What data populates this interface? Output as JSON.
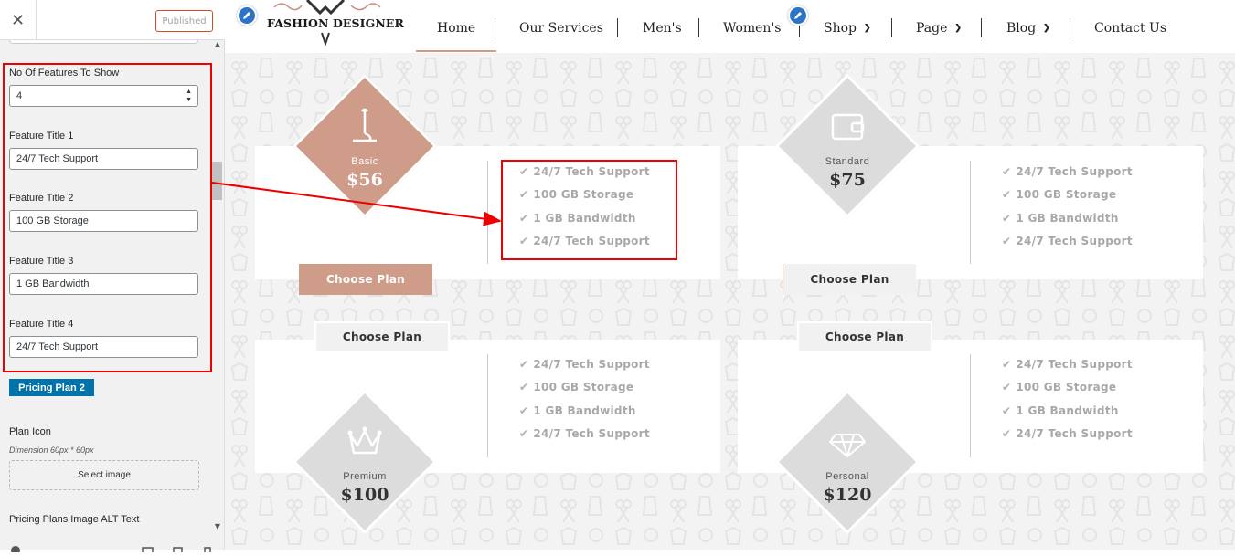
{
  "customizer": {
    "close_icon": "close-icon",
    "published_label": "Published",
    "features_count_label": "No Of Features To Show",
    "features_count_value": "4",
    "feature_fields": [
      {
        "label": "Feature Title 1",
        "value": "24/7 Tech Support"
      },
      {
        "label": "Feature Title 2",
        "value": "100 GB Storage"
      },
      {
        "label": "Feature Title 3",
        "value": "1 GB Bandwidth"
      },
      {
        "label": "Feature Title 4",
        "value": "24/7 Tech Support"
      }
    ],
    "section_button": "Pricing Plan 2",
    "plan_icon_label": "Plan Icon",
    "plan_icon_hint": "Dimension 60px * 60px",
    "select_image_label": "Select image",
    "alt_text_label": "Pricing Plans Image ALT Text"
  },
  "site": {
    "logo_text": "FASHION DESIGNER",
    "nav": [
      {
        "label": "Home"
      },
      {
        "label": "Our Services"
      },
      {
        "label": "Men's"
      },
      {
        "label": "Women's"
      },
      {
        "label": "Shop"
      },
      {
        "label": "Page"
      },
      {
        "label": "Blog"
      },
      {
        "label": "Contact Us"
      }
    ],
    "plans": [
      {
        "name": "Basic",
        "price": "$56",
        "icon": "needle-icon",
        "button": "Choose Plan"
      },
      {
        "name": "Standard",
        "price": "$75",
        "icon": "wallet-icon",
        "button": "Choose Plan"
      },
      {
        "name": "Premium",
        "price": "$100",
        "icon": "crown-icon",
        "button": "Choose Plan"
      },
      {
        "name": "Personal",
        "price": "$120",
        "icon": "diamond-icon",
        "button": "Choose Plan"
      }
    ],
    "features": [
      "24/7 Tech Support",
      "100 GB Storage",
      "1 GB Bandwidth",
      "24/7 Tech Support"
    ]
  },
  "colors": {
    "accent": "#d09c8a",
    "highlight": "#e00000",
    "wp_blue": "#0073aa",
    "grey_diamond": "#dcdcdc"
  }
}
